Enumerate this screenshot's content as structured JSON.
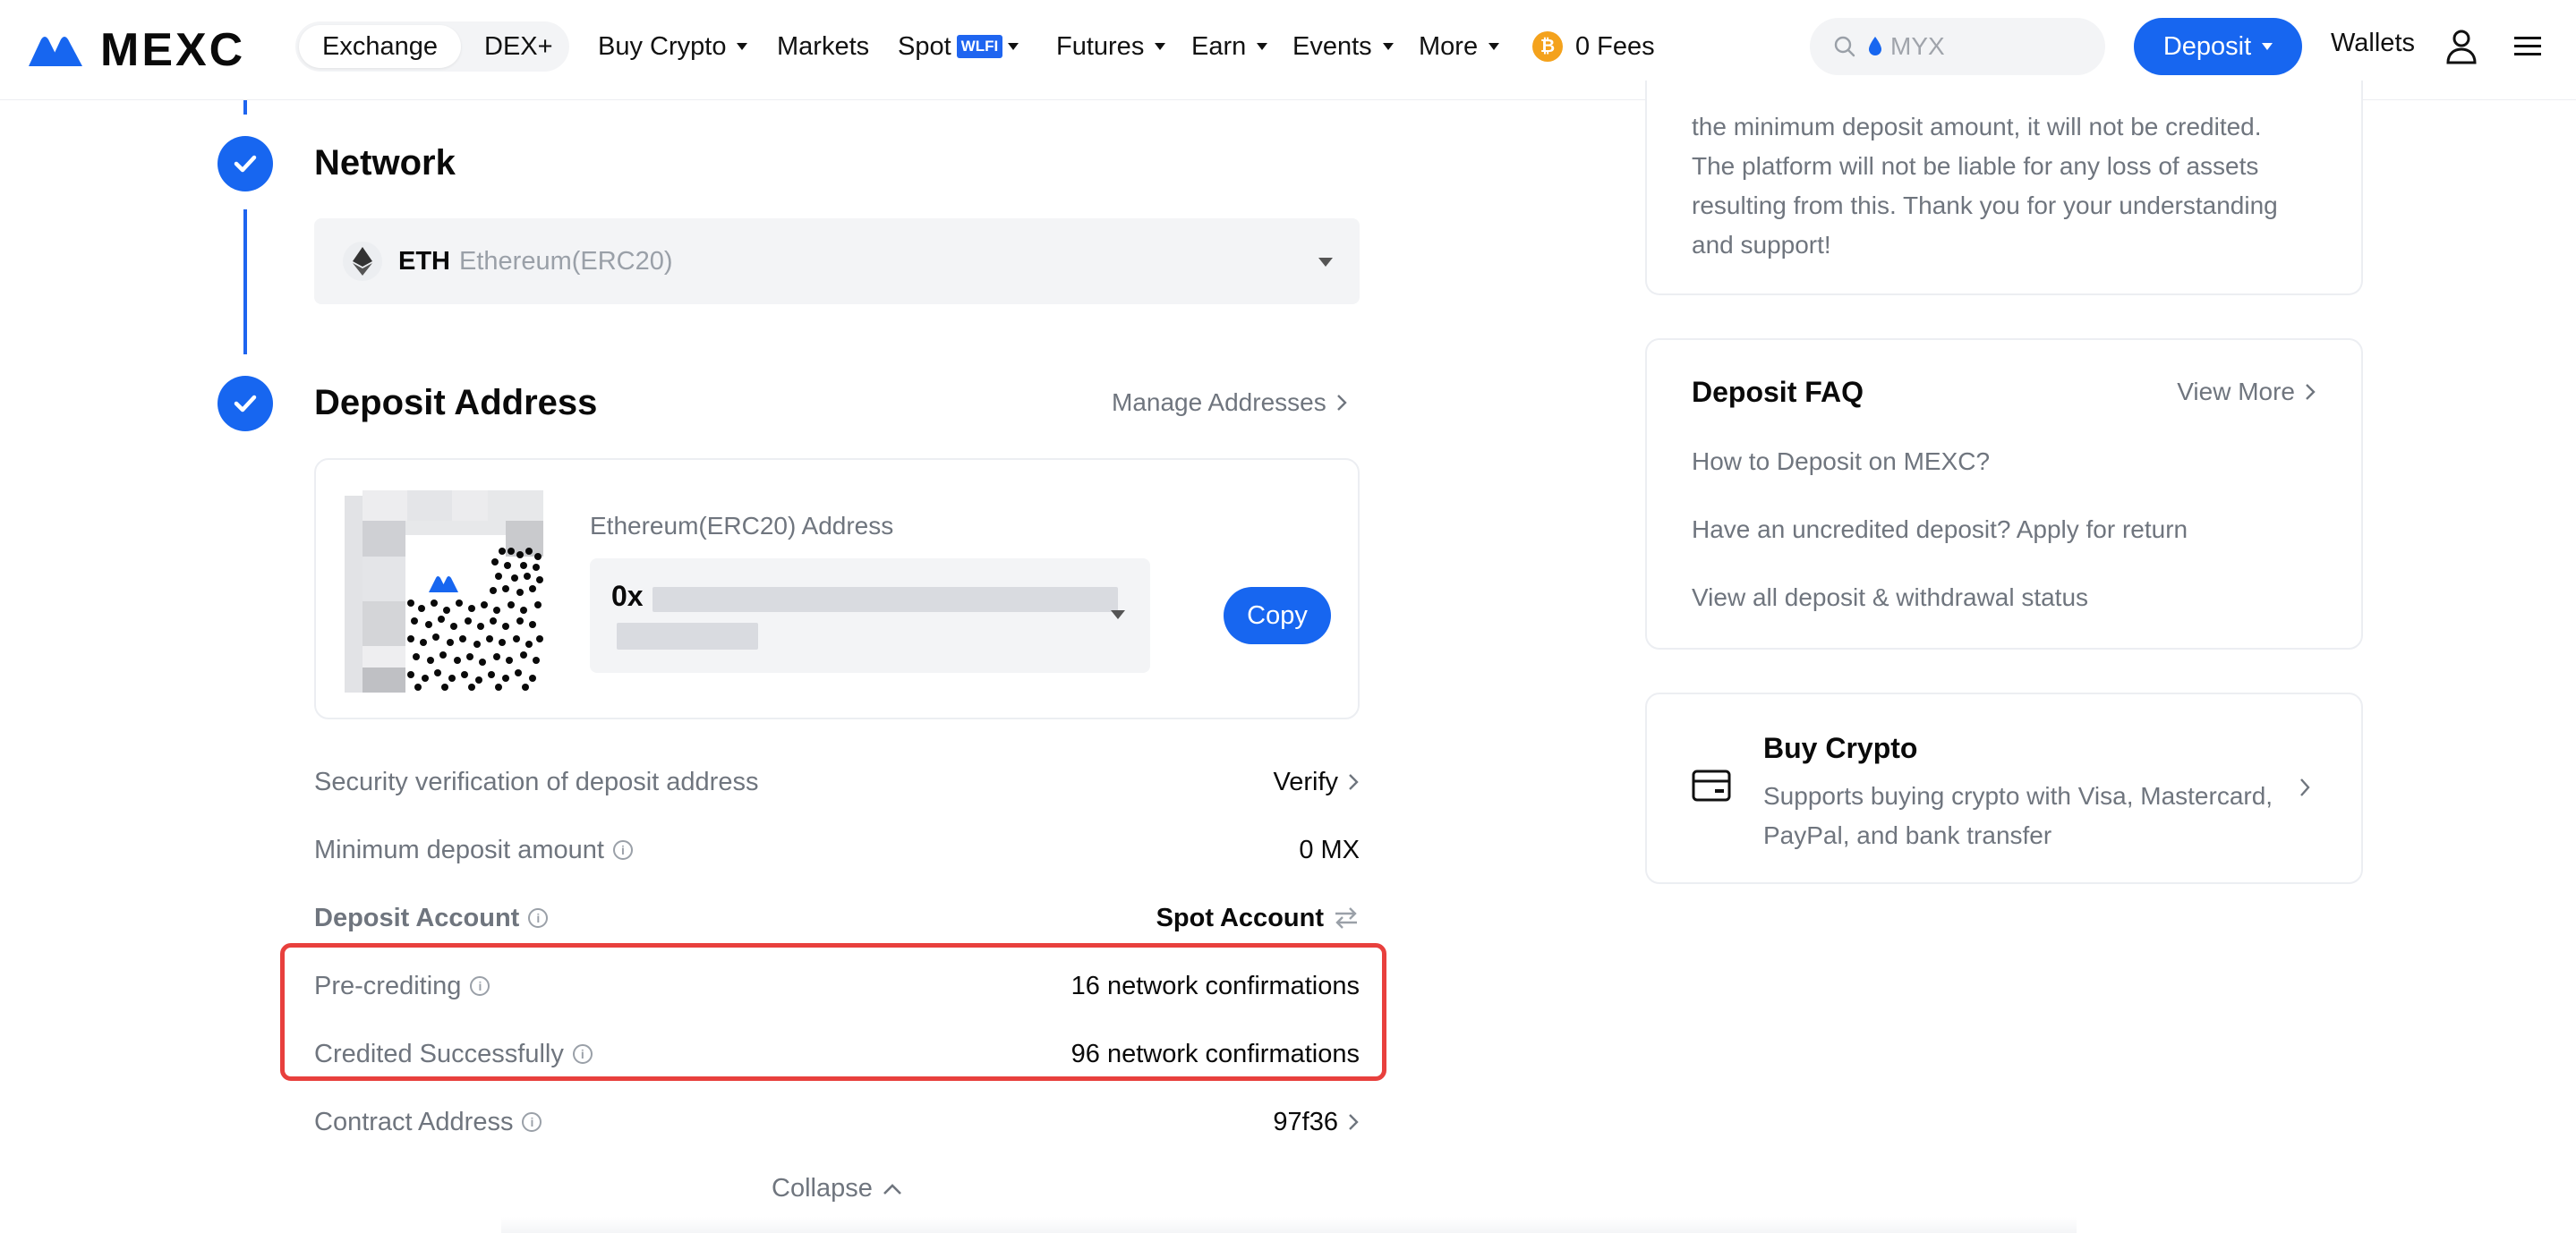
{
  "brand": {
    "name": "MEXC",
    "color": "#1766f0"
  },
  "header": {
    "tabs": [
      {
        "label": "Exchange",
        "active": true
      },
      {
        "label": "DEX+",
        "active": false
      }
    ],
    "nav": {
      "buy_crypto": "Buy Crypto",
      "markets": "Markets",
      "spot": "Spot",
      "spot_badge": "WLFI",
      "futures": "Futures",
      "earn": "Earn",
      "events": "Events",
      "more": "More",
      "fees": "0 Fees",
      "fees_coin_symbol": "₿"
    },
    "search": {
      "placeholder": "MYX"
    },
    "deposit_label": "Deposit",
    "wallets_label": "Wallets"
  },
  "network_step": {
    "title": "Network",
    "selected_code": "ETH",
    "selected_name": "Ethereum(ERC20)"
  },
  "deposit_step": {
    "title": "Deposit Address",
    "manage_label": "Manage Addresses",
    "address_label": "Ethereum(ERC20) Address",
    "address_prefix": "0x",
    "copy_label": "Copy"
  },
  "details": [
    {
      "label": "Security verification of deposit address",
      "value": "Verify",
      "info": false,
      "chevron": true
    },
    {
      "label": "Minimum deposit amount",
      "value": "0 MX",
      "info": true
    },
    {
      "label": "Deposit Account",
      "value": "Spot Account",
      "info": true,
      "switch": true
    },
    {
      "label": "Pre-crediting",
      "value": "16 network confirmations",
      "info": true
    },
    {
      "label": "Credited Successfully",
      "value": "96 network confirmations",
      "info": true
    },
    {
      "label": "Contract Address",
      "value": "97f36",
      "info": true,
      "chevron": true
    }
  ],
  "collapse_label": "Collapse",
  "notice": {
    "lines": [
      "the minimum deposit amount, it will not be credited.",
      "The platform will not be liable for any loss of assets",
      "resulting from this. Thank you for your understanding",
      "and support!"
    ]
  },
  "faq": {
    "title": "Deposit FAQ",
    "more_label": "View More",
    "links": [
      "How to Deposit on MEXC?",
      "Have an uncredited deposit? Apply for return",
      "View all deposit & withdrawal status"
    ]
  },
  "buy_crypto_card": {
    "title": "Buy Crypto",
    "description": "Supports buying crypto with Visa, Mastercard, PayPal, and bank transfer"
  },
  "colors": {
    "highlight": "#e8403d",
    "accent": "#1766f0"
  }
}
